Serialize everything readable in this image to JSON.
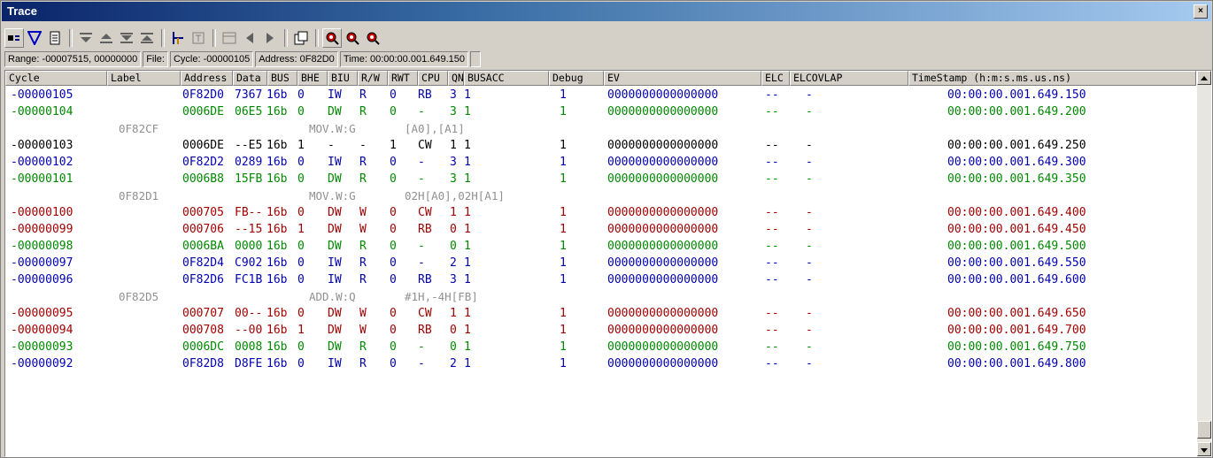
{
  "window": {
    "title": "Trace",
    "close_label": "×"
  },
  "toolbar": {
    "buttons": [
      "display-mode-icon",
      "filter-icon",
      "document-icon",
      "move-down-icon",
      "move-up-icon",
      "jump-bottom-icon",
      "jump-top-icon",
      "link-icon",
      "trigger-icon",
      "window-icon",
      "prev-icon",
      "next-icon",
      "copy-icon",
      "search-icon",
      "search-prev-icon",
      "search-next-icon"
    ]
  },
  "status": {
    "range": "Range: -00007515, 00000000",
    "file": "File:",
    "cycle": "Cycle: -00000105",
    "address": "Address: 0F82D0",
    "time": "Time: 00:00:00.001.649.150"
  },
  "columns": [
    "Cycle",
    "Label",
    "Address",
    "Data",
    "BUS",
    "BHE",
    "BIU",
    "R/W",
    "RWT",
    "CPU",
    "QN",
    "BUSACC",
    "Debug",
    "EV",
    "ELC",
    "ELCOVLAP",
    "TimeStamp (h:m:s.ms.us.ns)"
  ],
  "colors": {
    "blue": "#0000b0",
    "green": "#008800",
    "red": "#a00000",
    "black": "#000000",
    "gray": "#909090"
  },
  "rows": [
    {
      "type": "data",
      "color": "blue",
      "cells": [
        "-00000105",
        "",
        "0F82D0",
        "7367",
        "16b",
        "0",
        "IW",
        "R",
        "0",
        "RB",
        "3",
        "1",
        "1",
        "0000000000000000",
        "--",
        "-",
        "00:00:00.001.649.150"
      ]
    },
    {
      "type": "data",
      "color": "green",
      "cells": [
        "-00000104",
        "",
        "0006DE",
        "06E5",
        "16b",
        "0",
        "DW",
        "R",
        "0",
        "-",
        "3",
        "1",
        "1",
        "0000000000000000",
        "--",
        "-",
        "00:00:00.001.649.200"
      ]
    },
    {
      "type": "dis",
      "label": "0F82CF",
      "instr": "MOV.W:G",
      "operands": "[A0],[A1]"
    },
    {
      "type": "data",
      "color": "black",
      "cells": [
        "-00000103",
        "",
        "0006DE",
        "--E5",
        "16b",
        "1",
        "-",
        "-",
        "1",
        "CW",
        "1",
        "1",
        "1",
        "0000000000000000",
        "--",
        "-",
        "00:00:00.001.649.250"
      ]
    },
    {
      "type": "data",
      "color": "blue",
      "cells": [
        "-00000102",
        "",
        "0F82D2",
        "0289",
        "16b",
        "0",
        "IW",
        "R",
        "0",
        "-",
        "3",
        "1",
        "1",
        "0000000000000000",
        "--",
        "-",
        "00:00:00.001.649.300"
      ]
    },
    {
      "type": "data",
      "color": "green",
      "cells": [
        "-00000101",
        "",
        "0006B8",
        "15FB",
        "16b",
        "0",
        "DW",
        "R",
        "0",
        "-",
        "3",
        "1",
        "1",
        "0000000000000000",
        "--",
        "-",
        "00:00:00.001.649.350"
      ]
    },
    {
      "type": "dis",
      "label": "0F82D1",
      "instr": "MOV.W:G",
      "operands": "02H[A0],02H[A1]"
    },
    {
      "type": "data",
      "color": "red",
      "cells": [
        "-00000100",
        "",
        "000705",
        "FB--",
        "16b",
        "0",
        "DW",
        "W",
        "0",
        "CW",
        "1",
        "1",
        "1",
        "0000000000000000",
        "--",
        "-",
        "00:00:00.001.649.400"
      ]
    },
    {
      "type": "data",
      "color": "red",
      "cells": [
        "-00000099",
        "",
        "000706",
        "--15",
        "16b",
        "1",
        "DW",
        "W",
        "0",
        "RB",
        "0",
        "1",
        "1",
        "0000000000000000",
        "--",
        "-",
        "00:00:00.001.649.450"
      ]
    },
    {
      "type": "data",
      "color": "green",
      "cells": [
        "-00000098",
        "",
        "0006BA",
        "0000",
        "16b",
        "0",
        "DW",
        "R",
        "0",
        "-",
        "0",
        "1",
        "1",
        "0000000000000000",
        "--",
        "-",
        "00:00:00.001.649.500"
      ]
    },
    {
      "type": "data",
      "color": "blue",
      "cells": [
        "-00000097",
        "",
        "0F82D4",
        "C902",
        "16b",
        "0",
        "IW",
        "R",
        "0",
        "-",
        "2",
        "1",
        "1",
        "0000000000000000",
        "--",
        "-",
        "00:00:00.001.649.550"
      ]
    },
    {
      "type": "data",
      "color": "blue",
      "cells": [
        "-00000096",
        "",
        "0F82D6",
        "FC1B",
        "16b",
        "0",
        "IW",
        "R",
        "0",
        "RB",
        "3",
        "1",
        "1",
        "0000000000000000",
        "--",
        "-",
        "00:00:00.001.649.600"
      ]
    },
    {
      "type": "dis",
      "label": "0F82D5",
      "instr": "ADD.W:Q",
      "operands": "#1H,-4H[FB]"
    },
    {
      "type": "data",
      "color": "red",
      "cells": [
        "-00000095",
        "",
        "000707",
        "00--",
        "16b",
        "0",
        "DW",
        "W",
        "0",
        "CW",
        "1",
        "1",
        "1",
        "0000000000000000",
        "--",
        "-",
        "00:00:00.001.649.650"
      ]
    },
    {
      "type": "data",
      "color": "red",
      "cells": [
        "-00000094",
        "",
        "000708",
        "--00",
        "16b",
        "1",
        "DW",
        "W",
        "0",
        "RB",
        "0",
        "1",
        "1",
        "0000000000000000",
        "--",
        "-",
        "00:00:00.001.649.700"
      ]
    },
    {
      "type": "data",
      "color": "green",
      "cells": [
        "-00000093",
        "",
        "0006DC",
        "0008",
        "16b",
        "0",
        "DW",
        "R",
        "0",
        "-",
        "0",
        "1",
        "1",
        "0000000000000000",
        "--",
        "-",
        "00:00:00.001.649.750"
      ]
    },
    {
      "type": "data",
      "color": "blue",
      "cells": [
        "-00000092",
        "",
        "0F82D8",
        "D8FE",
        "16b",
        "0",
        "IW",
        "R",
        "0",
        "-",
        "2",
        "1",
        "1",
        "0000000000000000",
        "--",
        "-",
        "00:00:00.001.649.800"
      ]
    }
  ]
}
